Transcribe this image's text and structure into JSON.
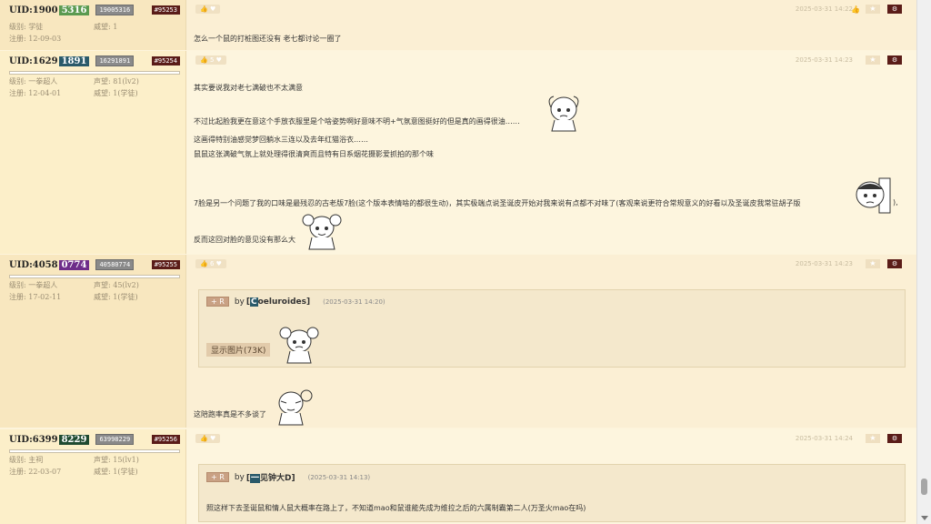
{
  "colors": {
    "green": "#5a9a50",
    "teal": "#2a5a6a",
    "purple": "#6e2d8a",
    "darkgreen": "#1f4a30",
    "floor": "#5a1c18"
  },
  "labels": {
    "level": "级别:",
    "prestige": "威望:",
    "fame": "声望:",
    "joined": "注册:",
    "by": "by",
    "show_image": "显示图片(73K)",
    "plus_r_plus": "+",
    "plus_r_r": "R"
  },
  "posts": [
    {
      "uid_prefix": "UID:1900",
      "uid_tail": "5316",
      "uid_box": "19005316",
      "floor": "#95253",
      "level": "学徒",
      "prestige": "1",
      "joined": "12-09-03",
      "likes": "",
      "time": "2025-03-31 14:22",
      "lines": [
        "怎么一个鼠的打桩图还没有 老七都讨论一圈了"
      ]
    },
    {
      "uid_prefix": "UID:1629",
      "uid_tail": "1891",
      "uid_box": "16291891",
      "floor": "#95254",
      "level": "一拳超人",
      "fame": "81(lv2)",
      "joined": "12-04-01",
      "prestige": "1(学徒)",
      "likes": "5",
      "time": "2025-03-31 14:23",
      "lines": [
        "其实要说我对老七满破也不太满意",
        "不过比起脸我更在意这个手放衣服里是个啥姿势啊好意味不明+气氛意图挺好的但是真的画得很油……",
        "这画得特别油感觉梦回躺水三连以及去年红猫浴衣……",
        "鼠鼠这张满破气氛上就处理得很清爽而且特有日系烟花摄影爱抓拍的那个味",
        "7脸是另一个问题了我的口味是最残忍的古老版7脸(这个版本表情啥的都很生动)，其实极端点说圣诞皮开始对我来说有点都不对味了(客观来说更符合常规意义的好看以及圣诞皮我常驻胡子版",
        "),",
        "反而这回对脸的意见没有那么大"
      ]
    },
    {
      "uid_prefix": "UID:4058",
      "uid_tail": "0774",
      "uid_box": "40580774",
      "floor": "#95255",
      "level": "一拳超人",
      "fame": "45(lv2)",
      "joined": "17-02-11",
      "prestige": "1(学徒)",
      "likes": "6",
      "time": "2025-03-31 14:23",
      "quote": {
        "initial": "C",
        "name": "oeluroides",
        "time": "(2025-03-31 14:20)"
      },
      "lines": [
        "这陪跑率真是不多谈了"
      ]
    },
    {
      "uid_prefix": "UID:6399",
      "uid_tail": "8229",
      "uid_box": "63998229",
      "floor": "#95256",
      "level": "主祠",
      "fame": "15(lv1)",
      "joined": "22-03-07",
      "prestige": "1(学徒)",
      "likes": "",
      "time": "2025-03-31 14:24",
      "quote": {
        "initial": "一",
        "name": "见钟大D",
        "time": "(2025-03-31 14:13)"
      },
      "lines": [
        "照这样下去圣诞鼠和情人鼠大概率在路上了，不知道mao和鼠谁能先成为维拉之后的六属制霸第二人(万圣火mao在吗)"
      ]
    }
  ]
}
